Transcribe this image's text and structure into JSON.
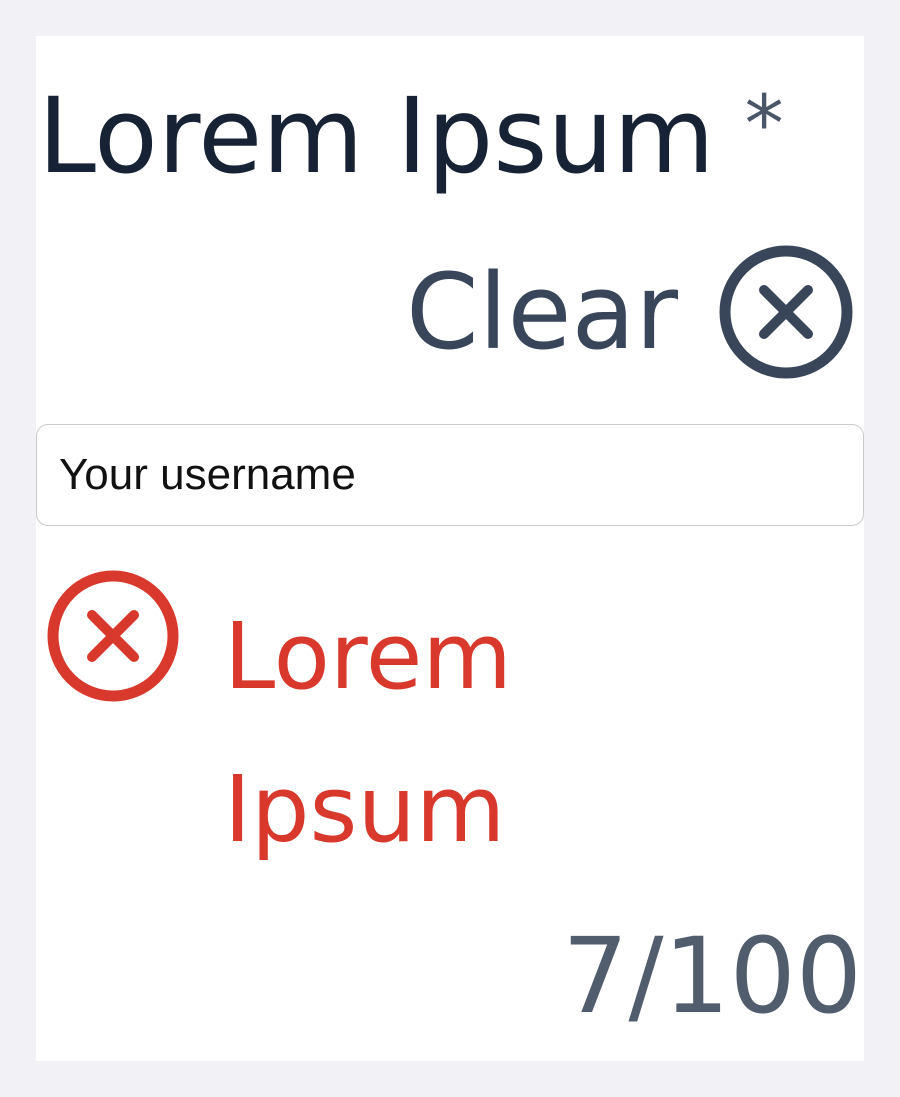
{
  "field": {
    "label": "Lorem Ipsum",
    "required_marker": "*",
    "clear_label": "Clear",
    "input_placeholder": "Your username",
    "input_value": "",
    "error_message": "Lorem Ipsum",
    "counter": "7/100"
  },
  "icons": {
    "clear": "close-circle-icon",
    "error": "error-circle-icon"
  },
  "colors": {
    "background": "#f1f1f6",
    "card": "#ffffff",
    "label_text": "#172234",
    "secondary_text": "#394659",
    "error": "#d8392c",
    "input_border": "#c9c9ce"
  }
}
